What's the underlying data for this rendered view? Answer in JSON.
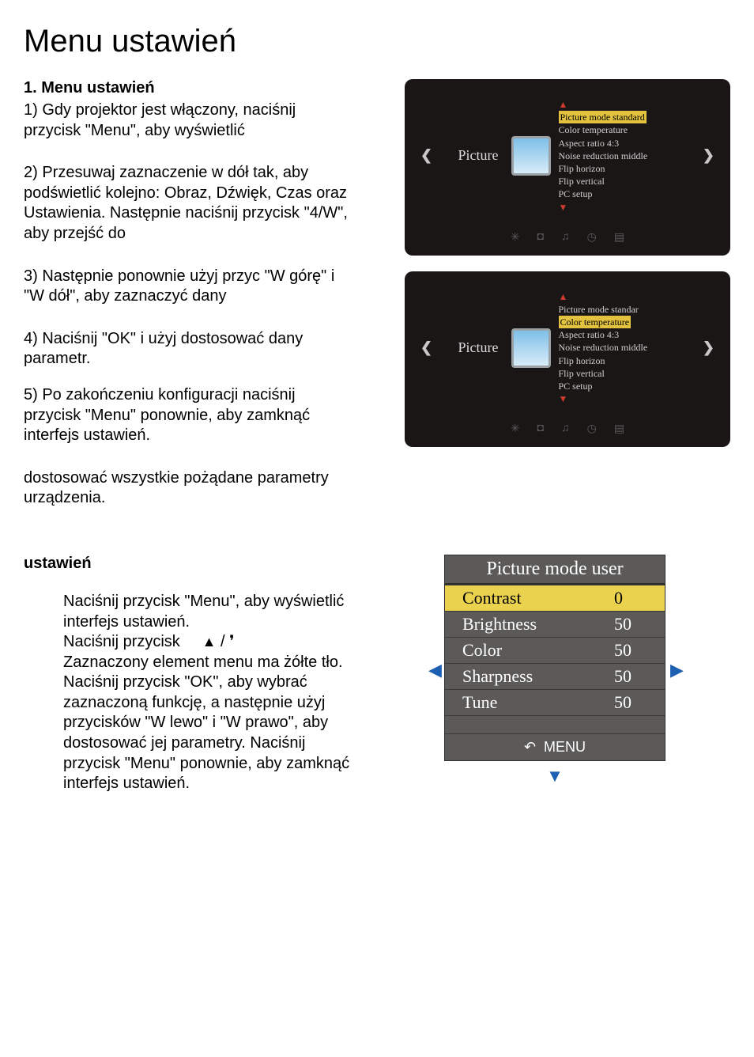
{
  "page_title": "Menu ustawień",
  "section1": {
    "heading": "1. Menu ustawień",
    "p1": "1) Gdy projektor jest włączony, naciśnij przycisk \"Menu\", aby wyświetlić",
    "p2": "2)  Przesuwaj zaznaczenie w dół tak, aby podświetlić kolejno: Obraz, Dźwięk, Czas oraz Ustawienia. Następnie naciśnij przycisk \"4/W\", aby przejść do",
    "p3": "3) Następnie ponownie użyj przyc \"W górę\" i \"W dół\", aby zaznaczyć dany",
    "p4": "4) Naciśnij \"OK\" i użyj dostosować dany parametr.",
    "p5": "5) Po zakończeniu konfiguracji naciśnij przycisk \"Menu\" ponownie, aby zamknąć interfejs ustawień.",
    "p6": "dostosować wszystkie pożądane parametry urządzenia."
  },
  "osd1": {
    "label": "Picture",
    "items": {
      "i0": "Picture mode standard",
      "i1": "Color temperature",
      "i2": "Aspect ratio 4:3",
      "i3": "Noise reduction middle",
      "i4": "Flip horizon",
      "i5": "Flip vertical",
      "i6": "PC setup"
    }
  },
  "osd2": {
    "label": "Picture",
    "items": {
      "i0": "Picture mode standar",
      "i1": "Color temperature",
      "i2": "Aspect ratio 4:3",
      "i3": "Noise reduction middle",
      "i4": "Flip horizon",
      "i5": "Flip vertical",
      "i6": "PC setup"
    }
  },
  "section2": {
    "heading": "ustawień",
    "l1": "Naciśnij przycisk \"Menu\", aby wyświetlić interfejs ustawień.",
    "l2a": "Naciśnij przycisk",
    "l3": "Zaznaczony element menu ma żółte tło.",
    "l4": "Naciśnij przycisk \"OK\", aby wybrać zaznaczoną funkcję, a następnie użyj przycisków \"W lewo\" i \"W prawo\", aby dostosować jej parametry. Naciśnij przycisk \"Menu\" ponownie, aby zamknąć interfejs ustawień."
  },
  "picture_mode": {
    "title": "Picture mode user",
    "rows": {
      "r0": {
        "label": "Contrast",
        "value": "0"
      },
      "r1": {
        "label": "Brightness",
        "value": "50"
      },
      "r2": {
        "label": "Color",
        "value": "50"
      },
      "r3": {
        "label": "Sharpness",
        "value": "50"
      },
      "r4": {
        "label": "Tune",
        "value": "50"
      }
    },
    "menu_label": "MENU"
  },
  "glyphs": {
    "left": "❮",
    "right": "❯",
    "up_red": "▲",
    "down_red": "▼",
    "left_blue": "◀",
    "right_blue": "▶",
    "down_blue": "▼",
    "tri_up": "▲",
    "slash": " / ",
    "tick": "❜",
    "gear": "✳",
    "speaker": "◘",
    "note": "♫",
    "clock": "◷",
    "grid": "▤"
  }
}
